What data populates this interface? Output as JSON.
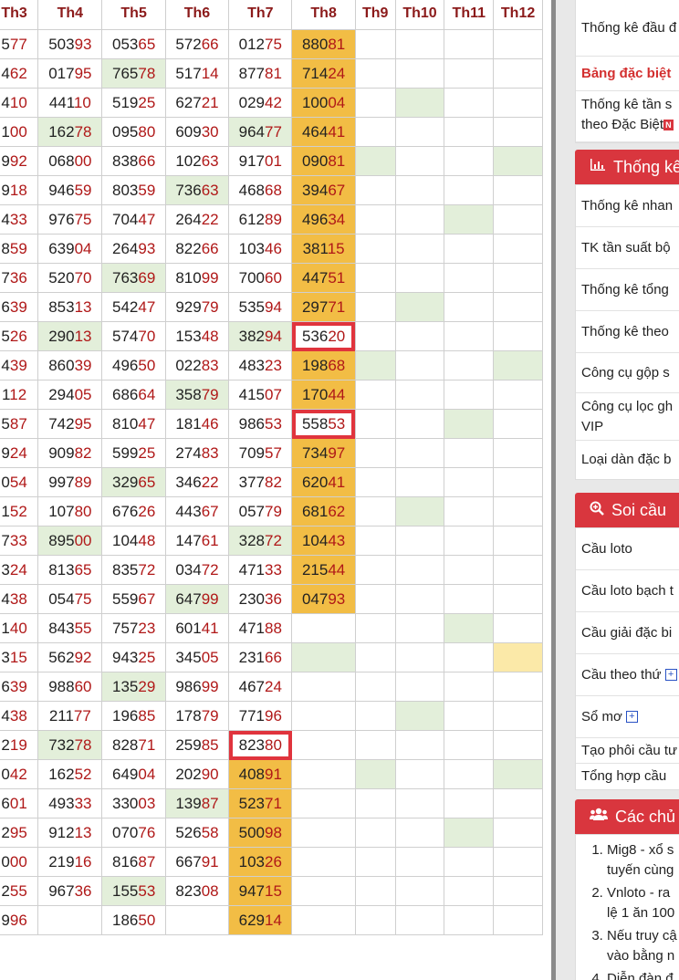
{
  "headers": [
    "Th3",
    "Th4",
    "Th5",
    "Th6",
    "Th7",
    "Th8",
    "Th9",
    "Th10",
    "Th11",
    "Th12"
  ],
  "rows": [
    [
      [
        "577",
        ""
      ],
      [
        "50393",
        ""
      ],
      [
        "05365",
        ""
      ],
      [
        "57266",
        ""
      ],
      [
        "01275",
        ""
      ],
      [
        "88081",
        "o"
      ],
      [
        "",
        ""
      ],
      [
        "",
        ""
      ],
      [
        "",
        ""
      ],
      [
        "",
        ""
      ]
    ],
    [
      [
        "462",
        ""
      ],
      [
        "01795",
        ""
      ],
      [
        "76578",
        "g"
      ],
      [
        "51714",
        ""
      ],
      [
        "87781",
        ""
      ],
      [
        "71424",
        "o"
      ],
      [
        "",
        ""
      ],
      [
        "",
        ""
      ],
      [
        "",
        ""
      ],
      [
        "",
        ""
      ]
    ],
    [
      [
        "410",
        ""
      ],
      [
        "44110",
        ""
      ],
      [
        "51925",
        ""
      ],
      [
        "62721",
        ""
      ],
      [
        "02942",
        ""
      ],
      [
        "10004",
        "o"
      ],
      [
        "",
        ""
      ],
      [
        "",
        "g"
      ],
      [
        "",
        ""
      ],
      [
        "",
        ""
      ]
    ],
    [
      [
        "100",
        ""
      ],
      [
        "16278",
        "g"
      ],
      [
        "09580",
        ""
      ],
      [
        "60930",
        ""
      ],
      [
        "96477",
        "g"
      ],
      [
        "46441",
        "o"
      ],
      [
        "",
        ""
      ],
      [
        "",
        ""
      ],
      [
        "",
        ""
      ],
      [
        "",
        ""
      ]
    ],
    [
      [
        "992",
        ""
      ],
      [
        "06800",
        ""
      ],
      [
        "83866",
        ""
      ],
      [
        "10263",
        ""
      ],
      [
        "91701",
        ""
      ],
      [
        "09081",
        "o"
      ],
      [
        "",
        "g"
      ],
      [
        "",
        ""
      ],
      [
        "",
        ""
      ],
      [
        "",
        "g"
      ]
    ],
    [
      [
        "918",
        ""
      ],
      [
        "94659",
        ""
      ],
      [
        "80359",
        ""
      ],
      [
        "73663",
        "g"
      ],
      [
        "46868",
        ""
      ],
      [
        "39467",
        "o"
      ],
      [
        "",
        ""
      ],
      [
        "",
        ""
      ],
      [
        "",
        ""
      ],
      [
        "",
        ""
      ]
    ],
    [
      [
        "433",
        ""
      ],
      [
        "97675",
        ""
      ],
      [
        "70447",
        ""
      ],
      [
        "26422",
        ""
      ],
      [
        "61289",
        ""
      ],
      [
        "49634",
        "o"
      ],
      [
        "",
        ""
      ],
      [
        "",
        ""
      ],
      [
        "",
        "g"
      ],
      [
        "",
        ""
      ]
    ],
    [
      [
        "859",
        ""
      ],
      [
        "63904",
        ""
      ],
      [
        "26493",
        ""
      ],
      [
        "82266",
        ""
      ],
      [
        "10346",
        ""
      ],
      [
        "38115",
        "o"
      ],
      [
        "",
        ""
      ],
      [
        "",
        ""
      ],
      [
        "",
        ""
      ],
      [
        "",
        ""
      ]
    ],
    [
      [
        "736",
        ""
      ],
      [
        "52070",
        ""
      ],
      [
        "76369",
        "g"
      ],
      [
        "81099",
        ""
      ],
      [
        "70060",
        ""
      ],
      [
        "44751",
        "o"
      ],
      [
        "",
        ""
      ],
      [
        "",
        ""
      ],
      [
        "",
        ""
      ],
      [
        "",
        ""
      ]
    ],
    [
      [
        "639",
        ""
      ],
      [
        "85313",
        ""
      ],
      [
        "54247",
        ""
      ],
      [
        "92979",
        ""
      ],
      [
        "53594",
        ""
      ],
      [
        "29771",
        "o"
      ],
      [
        "",
        ""
      ],
      [
        "",
        "g"
      ],
      [
        "",
        ""
      ],
      [
        "",
        ""
      ]
    ],
    [
      [
        "526",
        ""
      ],
      [
        "29013",
        "g"
      ],
      [
        "57470",
        ""
      ],
      [
        "15348",
        ""
      ],
      [
        "38294",
        "g"
      ],
      [
        "53620",
        "hl"
      ],
      [
        "",
        ""
      ],
      [
        "",
        ""
      ],
      [
        "",
        ""
      ],
      [
        "",
        ""
      ]
    ],
    [
      [
        "439",
        ""
      ],
      [
        "86039",
        ""
      ],
      [
        "49650",
        ""
      ],
      [
        "02283",
        ""
      ],
      [
        "48323",
        ""
      ],
      [
        "19868",
        "o"
      ],
      [
        "",
        "g"
      ],
      [
        "",
        ""
      ],
      [
        "",
        ""
      ],
      [
        "",
        "g"
      ]
    ],
    [
      [
        "112",
        ""
      ],
      [
        "29405",
        ""
      ],
      [
        "68664",
        ""
      ],
      [
        "35879",
        "g"
      ],
      [
        "41507",
        ""
      ],
      [
        "17044",
        "o"
      ],
      [
        "",
        ""
      ],
      [
        "",
        ""
      ],
      [
        "",
        ""
      ],
      [
        "",
        ""
      ]
    ],
    [
      [
        "587",
        ""
      ],
      [
        "74295",
        ""
      ],
      [
        "81047",
        ""
      ],
      [
        "18146",
        ""
      ],
      [
        "98653",
        ""
      ],
      [
        "55853",
        "hl"
      ],
      [
        "",
        ""
      ],
      [
        "",
        ""
      ],
      [
        "",
        "g"
      ],
      [
        "",
        ""
      ]
    ],
    [
      [
        "924",
        ""
      ],
      [
        "90982",
        ""
      ],
      [
        "59925",
        ""
      ],
      [
        "27483",
        ""
      ],
      [
        "70957",
        ""
      ],
      [
        "73497",
        "o"
      ],
      [
        "",
        ""
      ],
      [
        "",
        ""
      ],
      [
        "",
        ""
      ],
      [
        "",
        ""
      ]
    ],
    [
      [
        "054",
        ""
      ],
      [
        "99789",
        ""
      ],
      [
        "32965",
        "g"
      ],
      [
        "34622",
        ""
      ],
      [
        "37782",
        ""
      ],
      [
        "62041",
        "o"
      ],
      [
        "",
        ""
      ],
      [
        "",
        ""
      ],
      [
        "",
        ""
      ],
      [
        "",
        ""
      ]
    ],
    [
      [
        "152",
        ""
      ],
      [
        "10780",
        ""
      ],
      [
        "67626",
        ""
      ],
      [
        "44367",
        ""
      ],
      [
        "05779",
        ""
      ],
      [
        "68162",
        "o"
      ],
      [
        "",
        ""
      ],
      [
        "",
        "g"
      ],
      [
        "",
        ""
      ],
      [
        "",
        ""
      ]
    ],
    [
      [
        "733",
        ""
      ],
      [
        "89500",
        "g"
      ],
      [
        "10448",
        ""
      ],
      [
        "14761",
        ""
      ],
      [
        "32872",
        "g"
      ],
      [
        "10443",
        "o"
      ],
      [
        "",
        ""
      ],
      [
        "",
        ""
      ],
      [
        "",
        ""
      ],
      [
        "",
        ""
      ]
    ],
    [
      [
        "324",
        ""
      ],
      [
        "81365",
        ""
      ],
      [
        "83572",
        ""
      ],
      [
        "03472",
        ""
      ],
      [
        "47133",
        ""
      ],
      [
        "21544",
        "o"
      ],
      [
        "",
        ""
      ],
      [
        "",
        ""
      ],
      [
        "",
        ""
      ],
      [
        "",
        ""
      ]
    ],
    [
      [
        "438",
        ""
      ],
      [
        "05475",
        ""
      ],
      [
        "55967",
        ""
      ],
      [
        "64799",
        "g"
      ],
      [
        "23036",
        ""
      ],
      [
        "04793",
        "o"
      ],
      [
        "",
        ""
      ],
      [
        "",
        ""
      ],
      [
        "",
        ""
      ],
      [
        "",
        ""
      ]
    ],
    [
      [
        "140",
        ""
      ],
      [
        "84355",
        ""
      ],
      [
        "75723",
        ""
      ],
      [
        "60141",
        ""
      ],
      [
        "47188",
        ""
      ],
      [
        "",
        ""
      ],
      [
        "",
        ""
      ],
      [
        "",
        ""
      ],
      [
        "",
        "g"
      ],
      [
        "",
        ""
      ]
    ],
    [
      [
        "315",
        ""
      ],
      [
        "56292",
        ""
      ],
      [
        "94325",
        ""
      ],
      [
        "34505",
        ""
      ],
      [
        "23166",
        ""
      ],
      [
        "",
        "g"
      ],
      [
        "",
        ""
      ],
      [
        "",
        ""
      ],
      [
        "",
        ""
      ],
      [
        "",
        "y"
      ]
    ],
    [
      [
        "639",
        ""
      ],
      [
        "98860",
        ""
      ],
      [
        "13529",
        "g"
      ],
      [
        "98699",
        ""
      ],
      [
        "46724",
        ""
      ],
      [
        "",
        ""
      ],
      [
        "",
        ""
      ],
      [
        "",
        ""
      ],
      [
        "",
        ""
      ],
      [
        "",
        ""
      ]
    ],
    [
      [
        "438",
        ""
      ],
      [
        "21177",
        ""
      ],
      [
        "19685",
        ""
      ],
      [
        "17879",
        ""
      ],
      [
        "77196",
        ""
      ],
      [
        "",
        ""
      ],
      [
        "",
        ""
      ],
      [
        "",
        "g"
      ],
      [
        "",
        ""
      ],
      [
        "",
        ""
      ]
    ],
    [
      [
        "219",
        ""
      ],
      [
        "73278",
        "g"
      ],
      [
        "82871",
        ""
      ],
      [
        "25985",
        ""
      ],
      [
        "82380",
        "hl"
      ],
      [
        "",
        ""
      ],
      [
        "",
        ""
      ],
      [
        "",
        ""
      ],
      [
        "",
        ""
      ],
      [
        "",
        ""
      ]
    ],
    [
      [
        "042",
        ""
      ],
      [
        "16252",
        ""
      ],
      [
        "64904",
        ""
      ],
      [
        "20290",
        ""
      ],
      [
        "40891",
        "o"
      ],
      [
        "",
        ""
      ],
      [
        "",
        "g"
      ],
      [
        "",
        ""
      ],
      [
        "",
        ""
      ],
      [
        "",
        "g"
      ]
    ],
    [
      [
        "601",
        ""
      ],
      [
        "49333",
        ""
      ],
      [
        "33003",
        ""
      ],
      [
        "13987",
        "g"
      ],
      [
        "52371",
        "o"
      ],
      [
        "",
        ""
      ],
      [
        "",
        ""
      ],
      [
        "",
        ""
      ],
      [
        "",
        ""
      ],
      [
        "",
        ""
      ]
    ],
    [
      [
        "295",
        ""
      ],
      [
        "91213",
        ""
      ],
      [
        "07076",
        ""
      ],
      [
        "52658",
        ""
      ],
      [
        "50098",
        "o"
      ],
      [
        "",
        ""
      ],
      [
        "",
        ""
      ],
      [
        "",
        ""
      ],
      [
        "",
        "g"
      ],
      [
        "",
        ""
      ]
    ],
    [
      [
        "000",
        ""
      ],
      [
        "21916",
        ""
      ],
      [
        "81687",
        ""
      ],
      [
        "66791",
        ""
      ],
      [
        "10326",
        "o"
      ],
      [
        "",
        ""
      ],
      [
        "",
        ""
      ],
      [
        "",
        ""
      ],
      [
        "",
        ""
      ],
      [
        "",
        ""
      ]
    ],
    [
      [
        "255",
        ""
      ],
      [
        "96736",
        ""
      ],
      [
        "15553",
        "g"
      ],
      [
        "82308",
        ""
      ],
      [
        "94715",
        "o"
      ],
      [
        "",
        ""
      ],
      [
        "",
        ""
      ],
      [
        "",
        ""
      ],
      [
        "",
        ""
      ],
      [
        "",
        ""
      ]
    ],
    [
      [
        "996",
        ""
      ],
      [
        "",
        ""
      ],
      [
        "18650",
        ""
      ],
      [
        "",
        ""
      ],
      [
        "62914",
        "o"
      ],
      [
        "",
        ""
      ],
      [
        "",
        ""
      ],
      [
        "",
        ""
      ],
      [
        "",
        ""
      ],
      [
        "",
        ""
      ]
    ]
  ],
  "sidebar": {
    "top_items": [
      "Thống kê đầu đ",
      "Bảng đặc biệt",
      "Thống kê tần s",
      "theo Đặc Biệt"
    ],
    "new_badge": "N",
    "stats_header": "Thống kê",
    "stats_items": [
      "Thống kê nhan",
      "TK tần suất bộ",
      "Thống kê tổng",
      "Thống kê theo",
      "Công cụ gộp s",
      "Công cụ lọc gh",
      "VIP",
      "Loại dàn đặc b"
    ],
    "soi_header": "Soi cầu",
    "soi_items": [
      "Cầu loto",
      "Cầu loto bạch t",
      "Cầu giải đặc bi",
      "Cầu theo thứ",
      "Sổ mơ",
      "Tạo phôi cầu tư",
      "Tổng hợp cầu"
    ],
    "news_header": "Các chủ",
    "news_items": [
      "Mig8 - xổ s",
      "tuyến cùng",
      "Vnloto - ra",
      "lệ 1 ăn 100",
      "Nếu truy cậ",
      "vào bằng n",
      "Diễn đàn đ"
    ]
  }
}
